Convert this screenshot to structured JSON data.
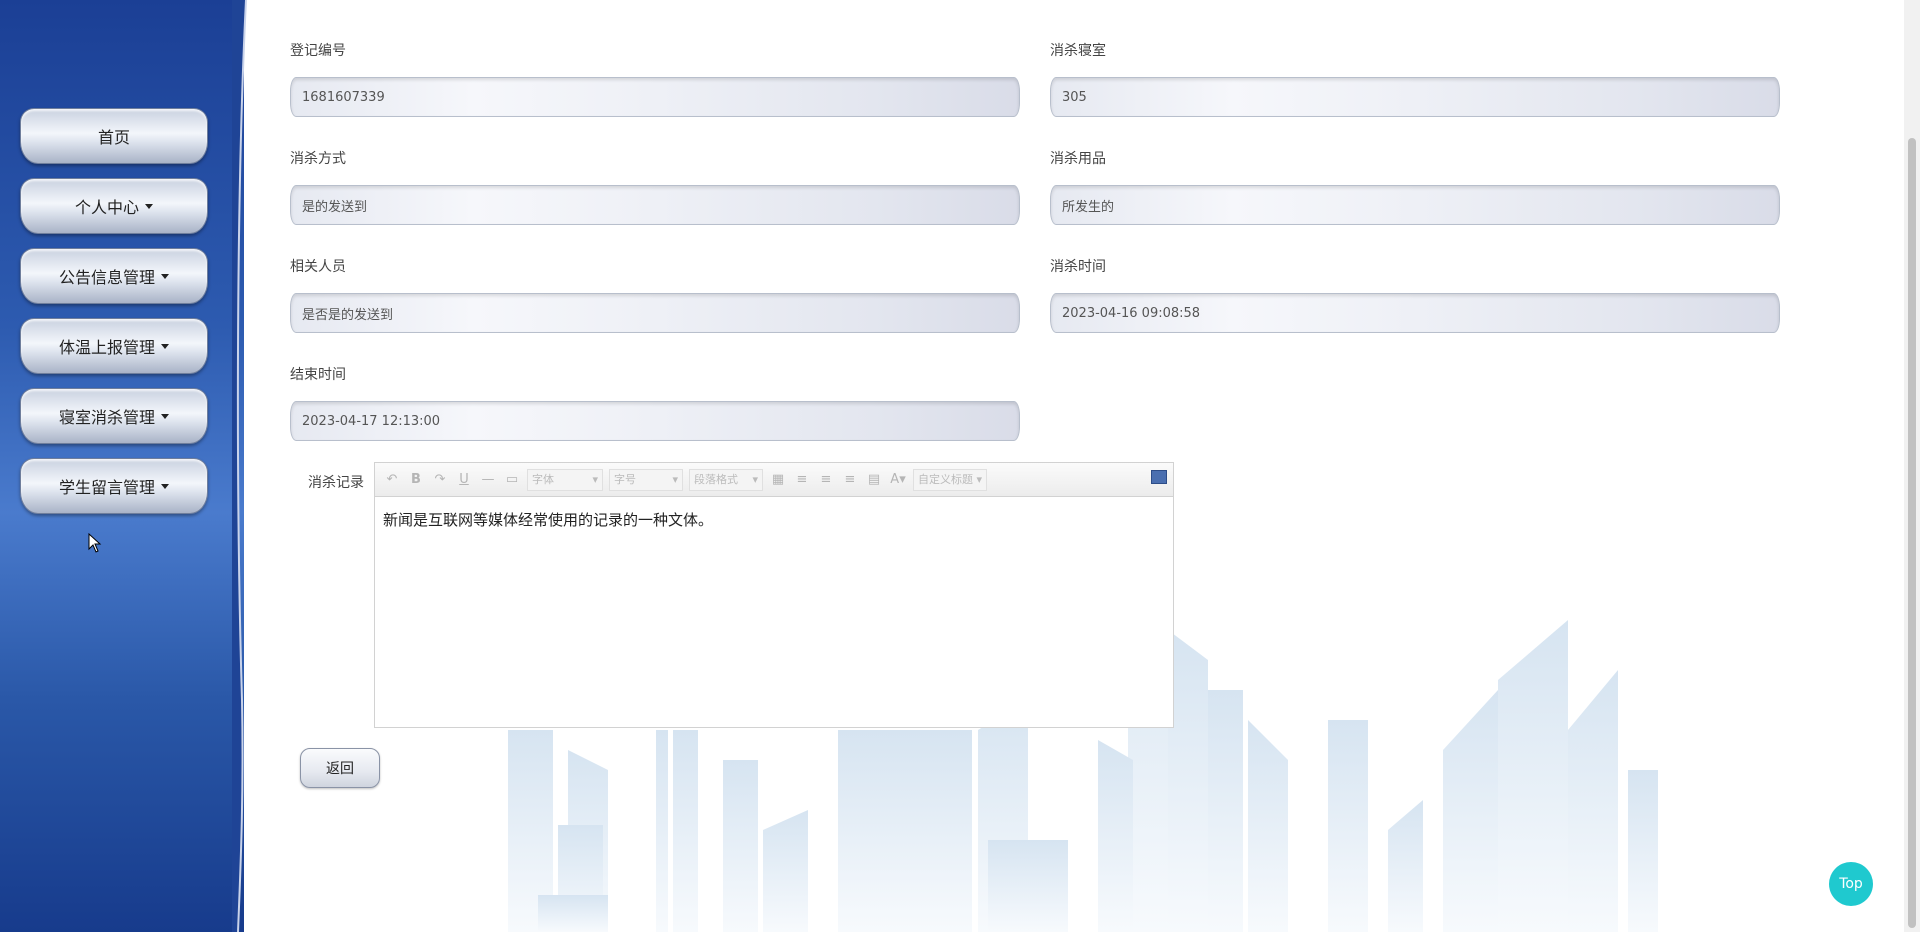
{
  "sidebar": {
    "items": [
      {
        "label": "首页",
        "dropdown": false
      },
      {
        "label": "个人中心",
        "dropdown": true
      },
      {
        "label": "公告信息管理",
        "dropdown": true
      },
      {
        "label": "体温上报管理",
        "dropdown": true
      },
      {
        "label": "寝室消杀管理",
        "dropdown": true
      },
      {
        "label": "学生留言管理",
        "dropdown": true
      }
    ]
  },
  "form": {
    "registration_no": {
      "label": "登记编号",
      "value": "1681607339"
    },
    "dorm": {
      "label": "消杀寝室",
      "value": "305"
    },
    "method": {
      "label": "消杀方式",
      "value": "是的发送到"
    },
    "supplies": {
      "label": "消杀用品",
      "value": "所发生的"
    },
    "personnel": {
      "label": "相关人员",
      "value": "是否是的发送到"
    },
    "disinfect_time": {
      "label": "消杀时间",
      "value": "2023-04-16 09:08:58"
    },
    "end_time": {
      "label": "结束时间",
      "value": "2023-04-17 12:13:00"
    },
    "record": {
      "label": "消杀记录",
      "content": "新闻是互联网等媒体经常使用的记录的一种文体。"
    }
  },
  "editor_toolbar": {
    "font_family": "字体",
    "font_size": "字号",
    "paragraph": "段落格式",
    "custom_title": "自定义标题",
    "bold": "B",
    "underline": "U",
    "font_color": "A"
  },
  "buttons": {
    "back": "返回",
    "top": "Top"
  },
  "colors": {
    "sidebar_top": "#1b3f95",
    "sidebar_mid": "#4a7bcd",
    "top_button": "#1fc9cf"
  }
}
